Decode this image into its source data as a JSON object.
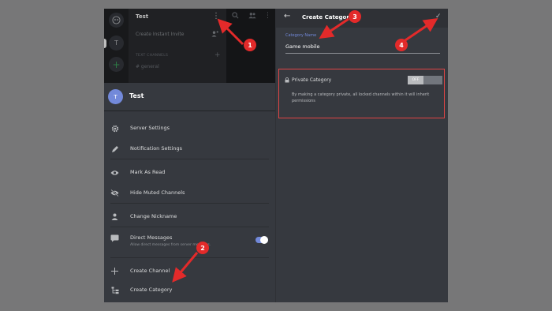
{
  "left": {
    "guild_rail": {
      "server_initial": "T",
      "add_label": "+"
    },
    "channel_header": {
      "title": "Test",
      "menu_icon": "⋮"
    },
    "channel_list": {
      "invite_label": "Create Instant Invite",
      "category_label": "TEXT CHANNELS",
      "channel_name": "# general"
    },
    "server": {
      "initial": "T",
      "name": "Test"
    },
    "menu": [
      {
        "label": "Server Settings",
        "icon": "gear-icon"
      },
      {
        "label": "Notification Settings",
        "icon": "pencil-icon"
      },
      {
        "label": "Mark As Read",
        "icon": "eye-icon"
      },
      {
        "label": "Hide Muted Channels",
        "icon": "eye-off-icon"
      },
      {
        "label": "Change Nickname",
        "icon": "person-icon"
      },
      {
        "label": "Direct Messages",
        "sub": "Allow direct messages from server members.",
        "icon": "message-icon",
        "toggle": "on"
      },
      {
        "label": "Create Channel",
        "icon": "plus-icon"
      },
      {
        "label": "Create Category",
        "icon": "category-icon"
      }
    ]
  },
  "right": {
    "title": "Create Category",
    "field_label": "Category Name",
    "field_value": "Game mobile",
    "private": {
      "title": "Private Category",
      "toggle_label": "OFF",
      "description": "By making a category private, all locked channels within it will inherit permissions"
    }
  },
  "callouts": [
    "1",
    "2",
    "3",
    "4"
  ],
  "colors": {
    "accent": "#7289da",
    "callout": "#e32a2a",
    "highlight_border": "#e04545"
  }
}
